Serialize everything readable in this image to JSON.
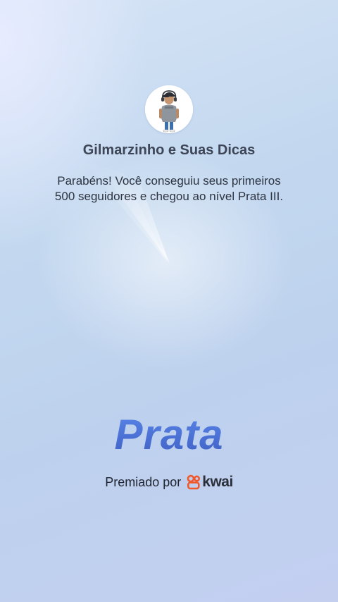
{
  "profile": {
    "name": "Gilmarzinho e Suas Dicas",
    "avatar_icon": "user-avatar-icon"
  },
  "message": {
    "line1": "Parabéns! Você conseguiu seus primeiros",
    "line2": "500 seguidores e chegou ao nível Prata III."
  },
  "tier": {
    "label": "Prata",
    "color": "#4a6fd4"
  },
  "award": {
    "prefix": "Premiado por",
    "brand": "kwai",
    "brand_icon": "kwai-logo-icon",
    "brand_color": "#f2582b"
  }
}
